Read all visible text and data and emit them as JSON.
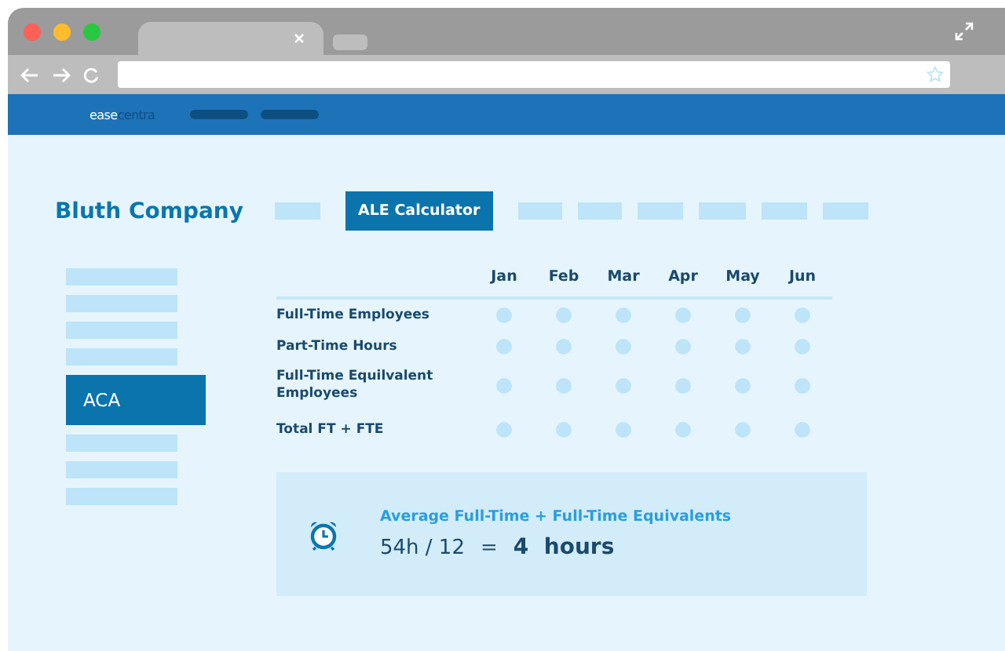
{
  "logo": {
    "first": "ease",
    "second": "centra"
  },
  "company": "Bluth Company",
  "tabs": [
    {
      "kind": "placeholder",
      "selected": false
    },
    {
      "kind": "tab",
      "label": "ALE Calculator",
      "selected": true
    },
    {
      "kind": "placeholder",
      "selected": false
    },
    {
      "kind": "placeholder",
      "selected": false
    },
    {
      "kind": "placeholder",
      "selected": false
    },
    {
      "kind": "placeholder",
      "selected": false
    },
    {
      "kind": "placeholder",
      "selected": false
    },
    {
      "kind": "placeholder",
      "selected": false
    }
  ],
  "sidebar": {
    "items": [
      {
        "kind": "placeholder",
        "selected": false
      },
      {
        "kind": "placeholder",
        "selected": false
      },
      {
        "kind": "placeholder",
        "selected": false
      },
      {
        "kind": "placeholder",
        "selected": false
      },
      {
        "kind": "item",
        "label": "ACA",
        "selected": true
      },
      {
        "kind": "placeholder",
        "selected": false
      },
      {
        "kind": "placeholder",
        "selected": false
      },
      {
        "kind": "placeholder",
        "selected": false
      }
    ]
  },
  "table": {
    "columns": [
      "Jan",
      "Feb",
      "Mar",
      "Apr",
      "May",
      "Jun"
    ],
    "rows": [
      "Full-Time Employees",
      "Part-Time Hours",
      "Full-Time Equilvalent Employees",
      "Total FT + FTE"
    ]
  },
  "summary": {
    "title": "Average Full-Time + Full-Time Equivalents",
    "formula": "54h / 12",
    "equals": "=",
    "result": "4  hours"
  }
}
